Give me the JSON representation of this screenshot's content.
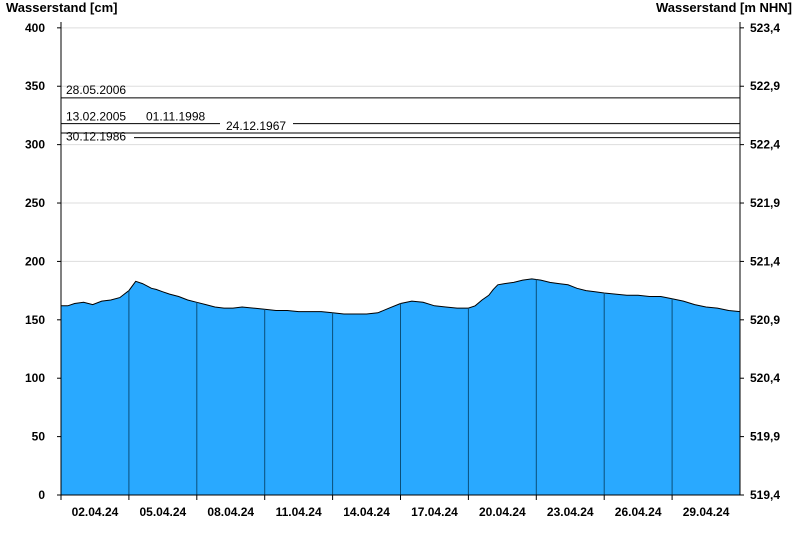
{
  "chart_data": {
    "type": "area",
    "ylabel_left": "Wasserstand [cm]",
    "ylabel_right": "Wasserstand [m NHN]",
    "ylim": [
      0,
      405
    ],
    "yticks_left": [
      0,
      50,
      100,
      150,
      200,
      250,
      300,
      350,
      400
    ],
    "yticks_right": [
      "519,4",
      "519,9",
      "520,4",
      "520,9",
      "521,4",
      "521,9",
      "522,4",
      "522,9",
      "523,4"
    ],
    "xticks": [
      "02.04.24",
      "05.04.24",
      "08.04.24",
      "11.04.24",
      "14.04.24",
      "17.04.24",
      "20.04.24",
      "23.04.24",
      "26.04.24",
      "29.04.24"
    ],
    "x_days_start": "2024-04-01",
    "x_days_span": 30,
    "grid": true,
    "fill_color": "#29a9ff",
    "line_color": "#000000",
    "annotation_lines": [
      {
        "label": "28.05.2006",
        "value": 340
      },
      {
        "label": "13.02.2005",
        "value": 318
      },
      {
        "label": "01.11.1998",
        "value": 318
      },
      {
        "label": "24.12.1967",
        "value": 310
      },
      {
        "label": "30.12.1986",
        "value": 306
      }
    ],
    "series": [
      {
        "x_days": [
          0,
          0.3,
          0.6,
          1,
          1.4,
          1.8,
          2.2,
          2.6,
          3,
          3.3,
          3.6,
          3.8,
          4,
          4.2,
          4.5,
          4.8,
          5.2,
          5.6,
          6,
          6.4,
          6.8,
          7.2,
          7.6,
          8,
          8.5,
          9,
          9.5,
          10,
          10.5,
          11,
          11.5,
          12,
          12.5,
          13,
          13.5,
          14,
          14.5,
          15,
          15.5,
          16,
          16.5,
          17,
          17.5,
          18,
          18.3,
          18.6,
          18.9,
          19.1,
          19.3,
          19.6,
          20,
          20.4,
          20.8,
          21.2,
          21.6,
          22,
          22.4,
          22.8,
          23.2,
          23.6,
          24,
          24.5,
          25,
          25.5,
          26,
          26.5,
          27,
          27.5,
          28,
          28.5,
          29,
          29.5,
          30
        ],
        "values": [
          162,
          162,
          164,
          165,
          163,
          166,
          167,
          169,
          175,
          183,
          181,
          179,
          177,
          176,
          174,
          172,
          170,
          167,
          165,
          163,
          161,
          160,
          160,
          161,
          160,
          159,
          158,
          158,
          157,
          157,
          157,
          156,
          155,
          155,
          155,
          156,
          160,
          164,
          166,
          165,
          162,
          161,
          160,
          160,
          162,
          167,
          171,
          176,
          180,
          181,
          182,
          184,
          185,
          184,
          182,
          181,
          180,
          177,
          175,
          174,
          173,
          172,
          171,
          171,
          170,
          170,
          168,
          166,
          163,
          161,
          160,
          158,
          157
        ]
      }
    ]
  }
}
